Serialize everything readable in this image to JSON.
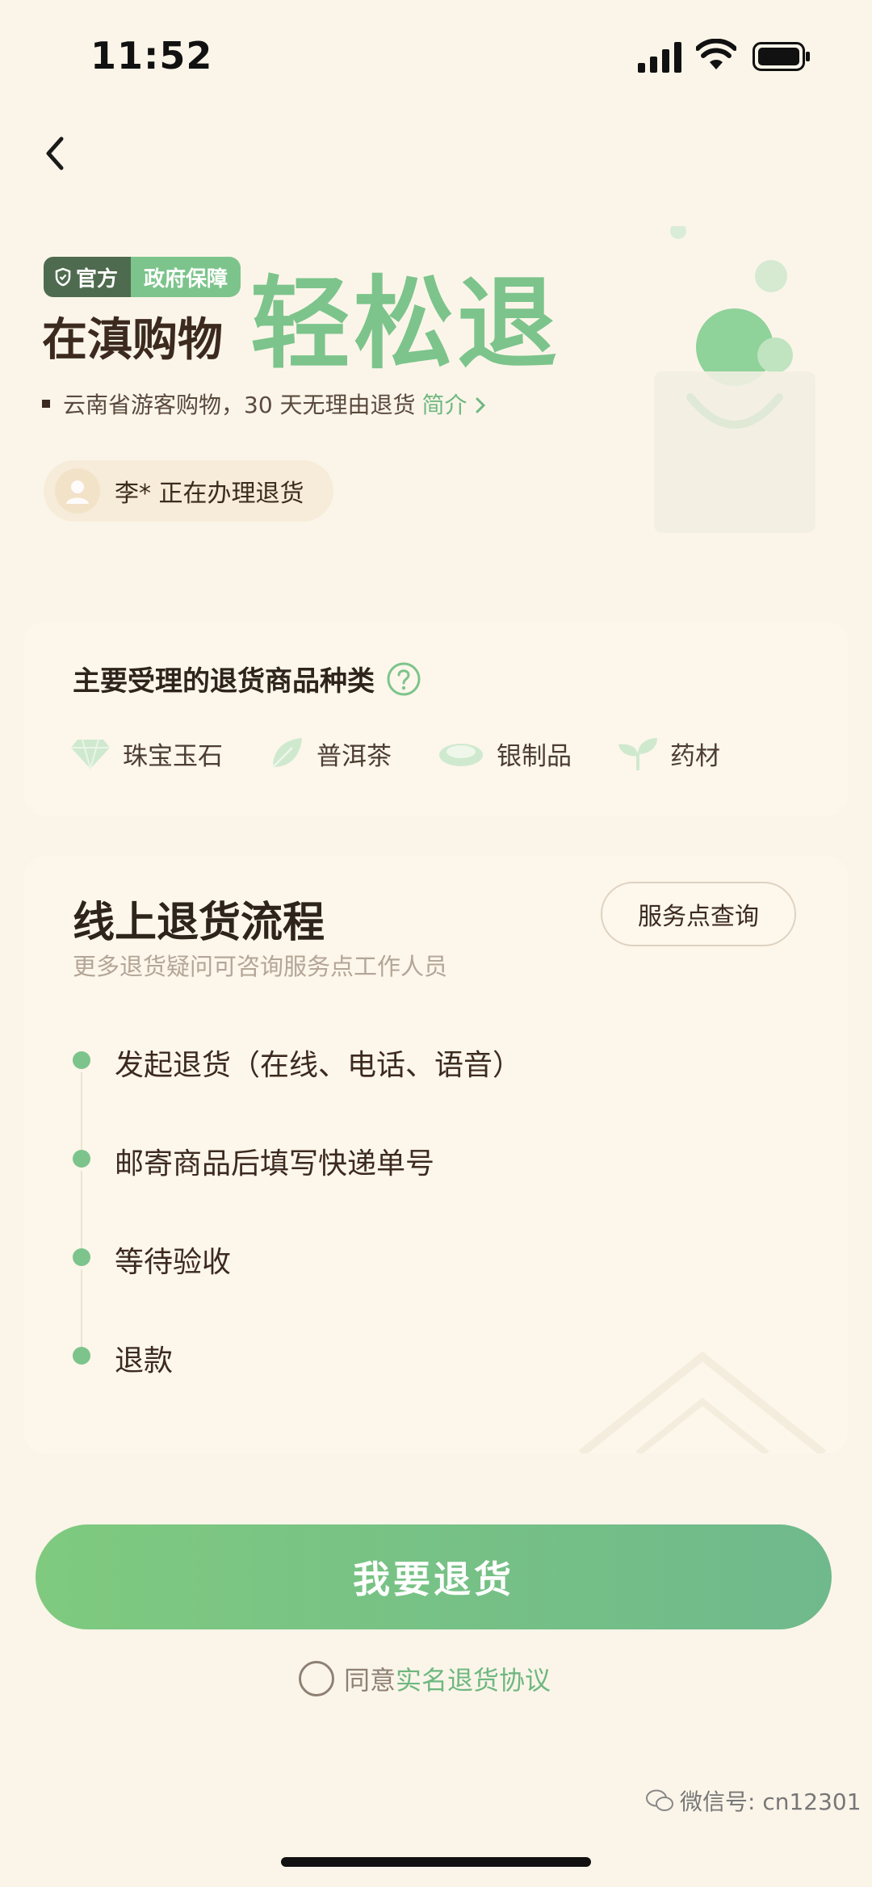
{
  "status_bar": {
    "time": "11:52"
  },
  "hero": {
    "badge_official": "官方",
    "badge_gov": "政府保障",
    "subtitle": "在滇购物",
    "title": "轻松退",
    "description": "云南省游客购物，30 天无理由退货",
    "intro_link": "简介",
    "processing_text": "李* 正在办理退货"
  },
  "categories": {
    "title": "主要受理的退货商品种类",
    "items": [
      {
        "label": "珠宝玉石",
        "icon": "gem-icon"
      },
      {
        "label": "普洱茶",
        "icon": "tea-leaf-icon"
      },
      {
        "label": "银制品",
        "icon": "silver-bracelet-icon"
      },
      {
        "label": "药材",
        "icon": "herb-sprout-icon"
      }
    ]
  },
  "process": {
    "title": "线上退货流程",
    "subtitle": "更多退货疑问可咨询服务点工作人员",
    "service_button": "服务点查询",
    "steps": [
      "发起退货（在线、电话、语音）",
      "邮寄商品后填写快递单号",
      "等待验收",
      "退款"
    ]
  },
  "primary_button": "我要退货",
  "agreement": {
    "prefix": "同意",
    "link": "实名退货协议"
  },
  "watermark": "微信号: cn12301",
  "colors": {
    "accent": "#7cc48b",
    "background": "#fbf5e9",
    "text": "#3c2a1f"
  }
}
